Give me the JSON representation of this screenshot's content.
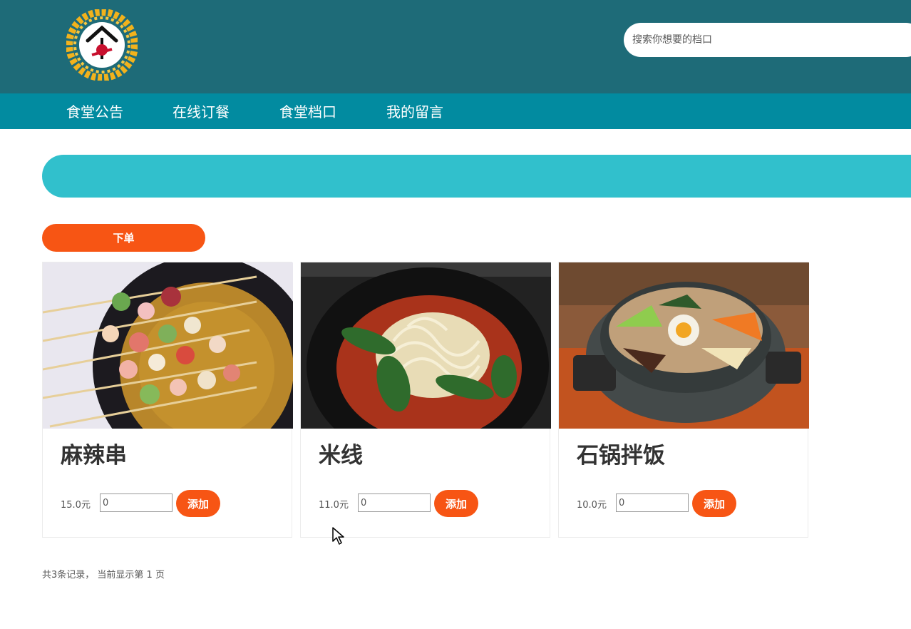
{
  "header": {
    "search_placeholder": "搜索你想要的档口"
  },
  "nav": {
    "items": [
      {
        "label": "食堂公告"
      },
      {
        "label": "在线订餐"
      },
      {
        "label": "食堂档口"
      },
      {
        "label": "我的留言"
      }
    ]
  },
  "order_button": {
    "label": "下单"
  },
  "products": [
    {
      "name": "麻辣串",
      "price": "15.0元",
      "quantity": "0",
      "add_label": "添加"
    },
    {
      "name": "米线",
      "price": "11.0元",
      "quantity": "0",
      "add_label": "添加"
    },
    {
      "name": "石锅拌饭",
      "price": "10.0元",
      "quantity": "0",
      "add_label": "添加"
    }
  ],
  "pagination": {
    "text": "共3条记录， 当前显示第 1 页"
  },
  "colors": {
    "header": "#1e6b78",
    "nav": "#028ba0",
    "banner": "#31c0cc",
    "accent": "#f75514"
  }
}
